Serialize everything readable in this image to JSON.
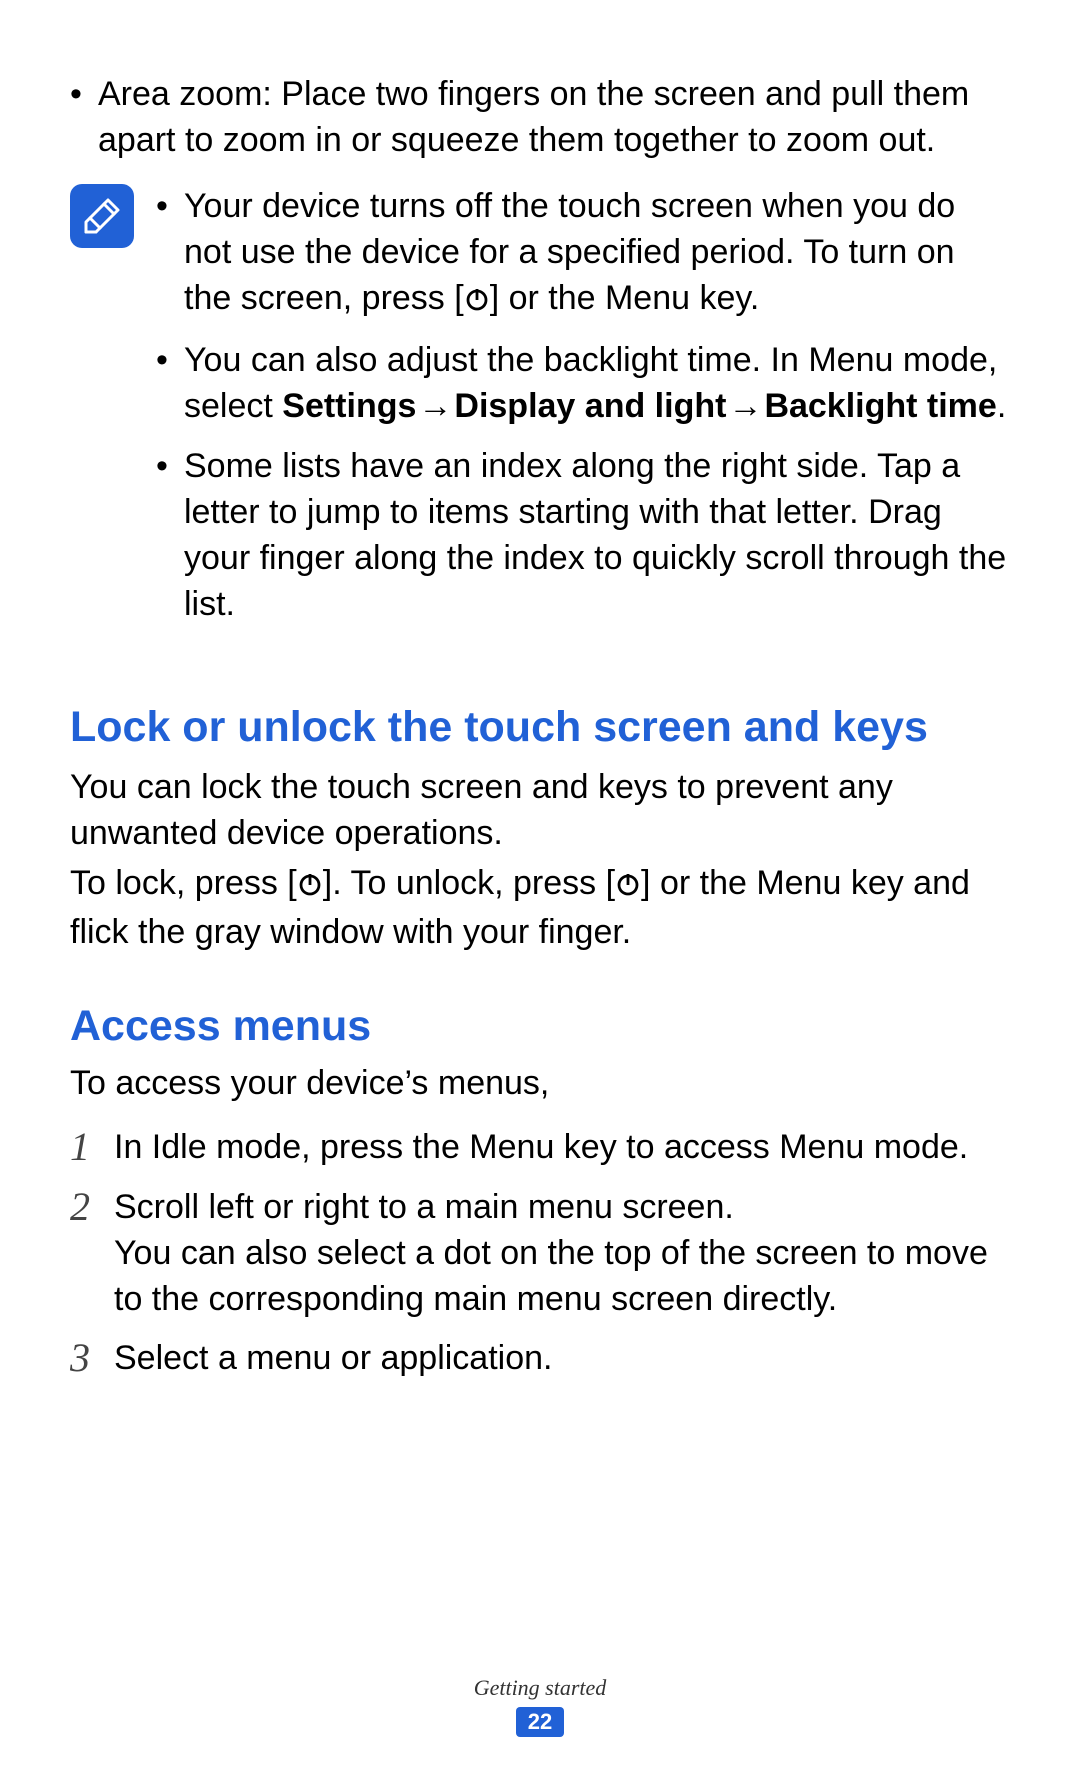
{
  "bullets": {
    "area_zoom": "Area zoom: Place two fingers on the screen and pull them apart to zoom in or squeeze them together to zoom out."
  },
  "note": {
    "item1_a": "Your device turns off the touch screen when you do not use the device for a specified period. To turn on the screen, press [",
    "item1_b": "] or the Menu key.",
    "item2_a": "You can also adjust the backlight time. In Menu mode, select ",
    "item2_bold_1": "Settings",
    "item2_arrow_1": " → ",
    "item2_bold_2": "Display and light",
    "item2_arrow_2": " → ",
    "item2_bold_3": "Backlight time",
    "item2_end": ".",
    "item3": "Some lists have an index along the right side. Tap a letter to jump to items starting with that letter. Drag your finger along the index to quickly scroll through the list."
  },
  "lock": {
    "heading": "Lock or unlock the touch screen and keys",
    "para1": "You can lock the touch screen and keys to prevent any unwanted device operations.",
    "para2_a": "To lock, press [",
    "para2_b": "]. To unlock, press [",
    "para2_c": "] or the Menu key and flick the gray window with your finger."
  },
  "access": {
    "heading": "Access menus",
    "intro": "To access your device’s menus,",
    "steps": {
      "s1_num": "1",
      "s1": "In Idle mode, press the Menu key to access Menu mode.",
      "s2_num": "2",
      "s2a": "Scroll left or right to a main menu screen.",
      "s2b": "You can also select a dot on the top of the screen to move to the corresponding main menu screen directly.",
      "s3_num": "3",
      "s3": "Select a menu or application."
    }
  },
  "footer": {
    "section": "Getting started",
    "page": "22"
  }
}
